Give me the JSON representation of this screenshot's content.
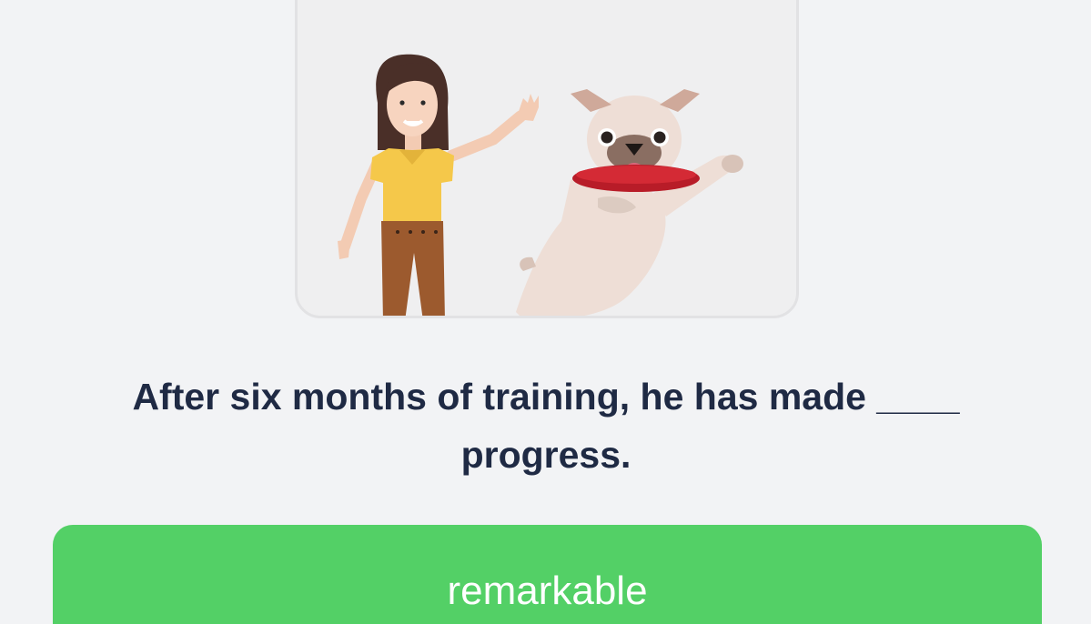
{
  "question": {
    "text": "After six months of training, he has made ____ progress."
  },
  "answer": {
    "label": "remarkable"
  },
  "illustration": {
    "icons": [
      "woman-figure",
      "pug-dog-icon",
      "frisbee-icon"
    ]
  },
  "colors": {
    "background": "#f2f3f5",
    "text": "#1f2a44",
    "answer_button": "#53d066",
    "answer_text": "#ffffff"
  }
}
